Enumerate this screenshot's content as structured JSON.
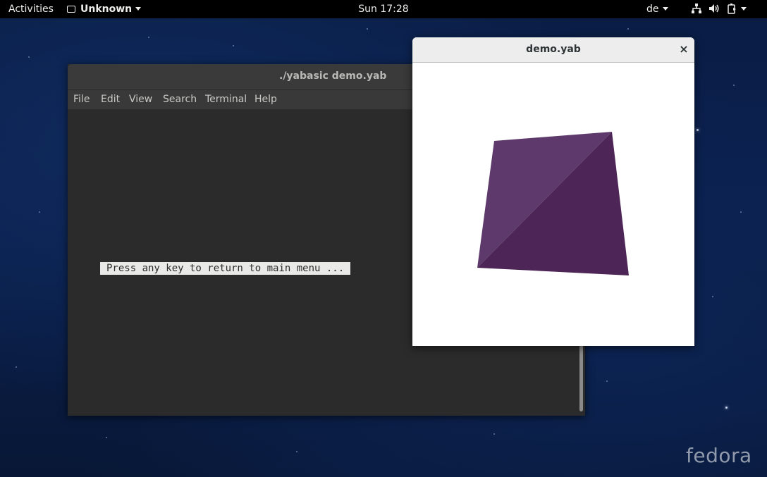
{
  "topbar": {
    "activities": "Activities",
    "app_name": "Unknown",
    "clock": "Sun 17:28",
    "language": "de",
    "status_icons": [
      "network-icon",
      "volume-icon",
      "battery-icon"
    ]
  },
  "terminal": {
    "title": "./yabasic demo.yab",
    "menu": {
      "file": "File",
      "edit": "Edit",
      "view": "View",
      "search": "Search",
      "terminal": "Terminal",
      "help": "Help"
    },
    "output_line": "Press any key to return to main menu ..."
  },
  "graphics_window": {
    "title": "demo.yab",
    "close_symbol": "×",
    "shape": {
      "color_light": "#5d3a6b",
      "color_dark": "#4d2657"
    }
  },
  "desktop": {
    "logo_text": "fedora"
  },
  "colors": {
    "topbar_bg": "#000000",
    "terminal_bg": "#2b2b2b",
    "desktop_bg": "#0b2150"
  }
}
